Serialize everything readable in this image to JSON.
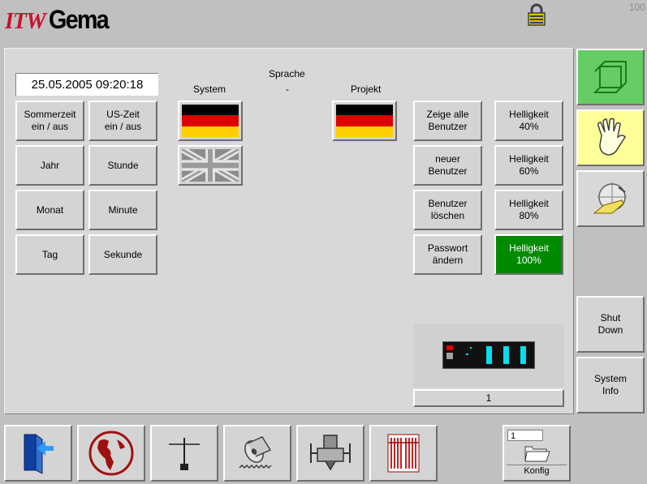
{
  "header": {
    "logo_itw": "ITW",
    "logo_gema": "Gema",
    "corner_number": "100"
  },
  "datetime": "25.05.2005 09:20:18",
  "time_buttons": [
    {
      "label": "Sommerzeit\nein / aus"
    },
    {
      "label": "US-Zeit\nein / aus"
    },
    {
      "label": "Jahr"
    },
    {
      "label": "Stunde"
    },
    {
      "label": "Monat"
    },
    {
      "label": "Minute"
    },
    {
      "label": "Tag"
    },
    {
      "label": "Sekunde"
    }
  ],
  "language": {
    "title": "Sprache",
    "dash": "-",
    "system_label": "System",
    "project_label": "Projekt"
  },
  "user_buttons": [
    {
      "label": "Zeige alle\nBenutzer"
    },
    {
      "label": "neuer\nBenutzer"
    },
    {
      "label": "Benutzer\nlöschen"
    },
    {
      "label": "Passwort\nändern"
    }
  ],
  "brightness_buttons": [
    {
      "label": "Helligkeit\n40%"
    },
    {
      "label": "Helligkeit\n60%"
    },
    {
      "label": "Helligkeit\n80%"
    },
    {
      "label": "Helligkeit\n100%",
      "active": true
    }
  ],
  "device": {
    "number": "1"
  },
  "side_buttons": {
    "shutdown": "Shut\nDown",
    "sysinfo": "System\nInfo"
  },
  "konfig": {
    "number": "1",
    "label": "Konfig"
  },
  "colors": {
    "active_green": "#008a00",
    "side_green": "#66cc66",
    "side_yellow": "#ffff99"
  }
}
